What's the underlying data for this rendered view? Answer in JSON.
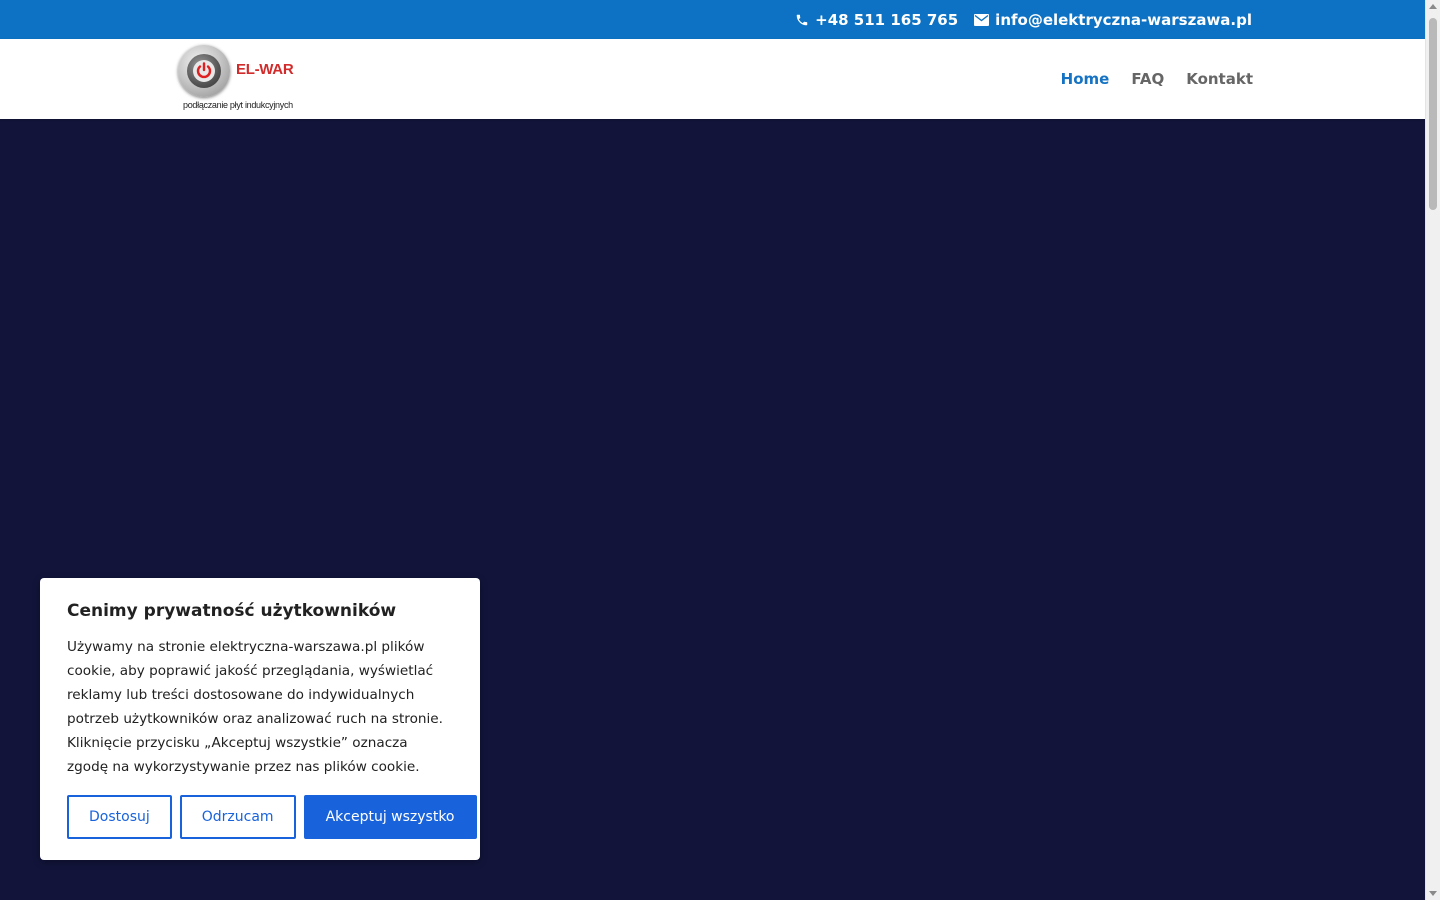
{
  "topbar": {
    "phone": "+48 511 165 765",
    "email": "info@elektryczna-warszawa.pl"
  },
  "logo": {
    "name": "EL-WAR",
    "tagline": "podłączanie płyt indukcyjnych"
  },
  "nav": {
    "items": [
      {
        "label": "Home",
        "active": true
      },
      {
        "label": "FAQ",
        "active": false
      },
      {
        "label": "Kontakt",
        "active": false
      }
    ]
  },
  "cookie": {
    "title": "Cenimy prywatność użytkowników",
    "body": "Używamy na stronie elektryczna-warszawa.pl plików cookie, aby poprawić jakość przeglądania, wyświetlać reklamy lub treści dostosowane do indywidualnych potrzeb użytkowników oraz analizować ruch na stronie. Kliknięcie przycisku „Akceptuj wszystkie” oznacza zgodę na wykorzystywanie przez nas plików cookie.",
    "customize_label": "Dostosuj",
    "reject_label": "Odrzucam",
    "accept_label": "Akceptuj wszystko"
  },
  "colors": {
    "topbar": "#0d72c3",
    "hero": "#12143a",
    "accent": "#1863dc",
    "nav_active": "#1673c4"
  },
  "icons": {
    "phone": "phone-icon",
    "email": "envelope-icon",
    "logo": "power-icon"
  }
}
